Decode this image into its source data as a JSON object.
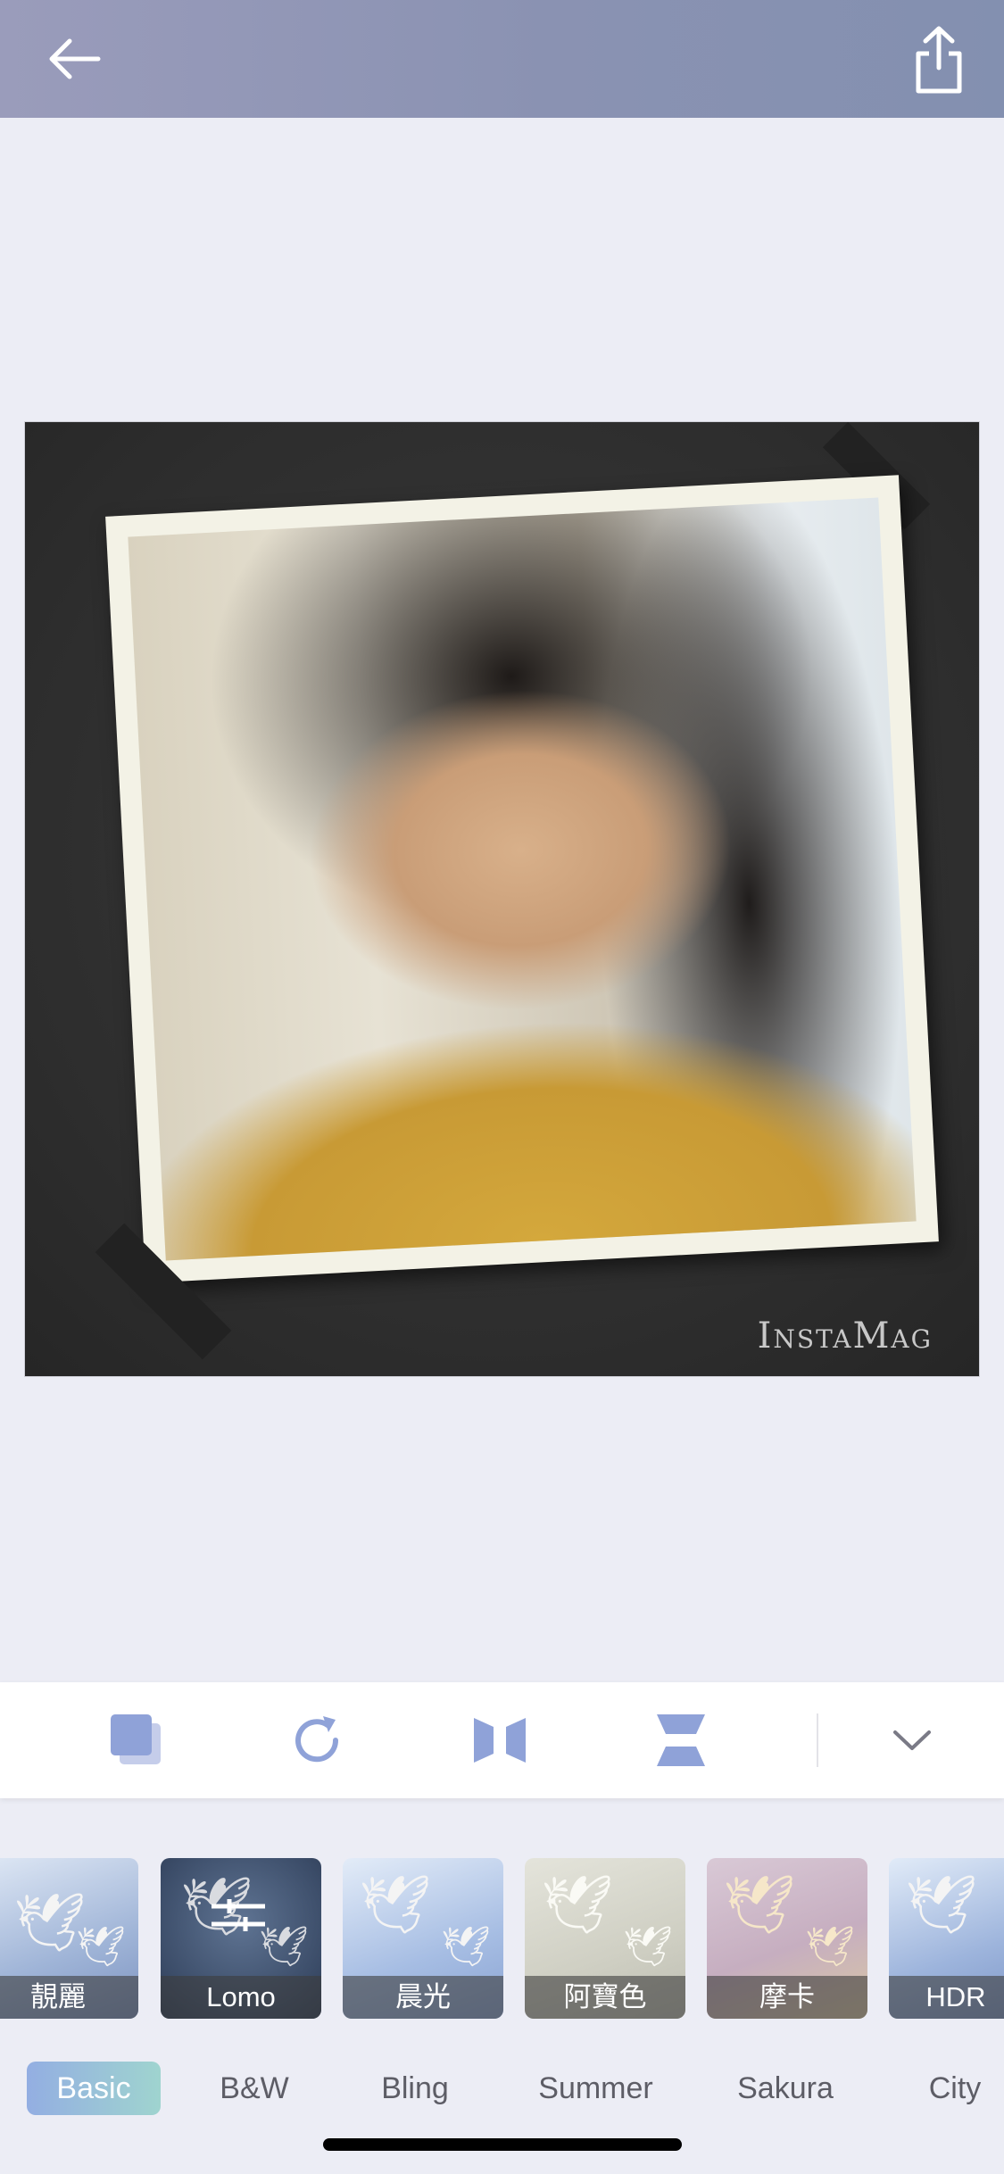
{
  "watermark": "InstaMag",
  "filters": [
    {
      "label": "靚麗"
    },
    {
      "label": "Lomo"
    },
    {
      "label": "晨光"
    },
    {
      "label": "阿寶色"
    },
    {
      "label": "摩卡"
    },
    {
      "label": "HDR"
    }
  ],
  "categories": [
    {
      "label": "Basic",
      "active": true
    },
    {
      "label": "B&W"
    },
    {
      "label": "Bling"
    },
    {
      "label": "Summer"
    },
    {
      "label": "Sakura"
    },
    {
      "label": "City"
    }
  ],
  "colors": {
    "topbar": "#8a92b2",
    "background": "#ecedf5",
    "accent": "#8fa2d8"
  },
  "icons": {
    "back": "arrow-left-icon",
    "share": "share-icon",
    "tools": [
      "layers-icon",
      "rotate-icon",
      "flip-horizontal-icon",
      "flip-vertical-icon",
      "chevron-down-icon"
    ]
  }
}
